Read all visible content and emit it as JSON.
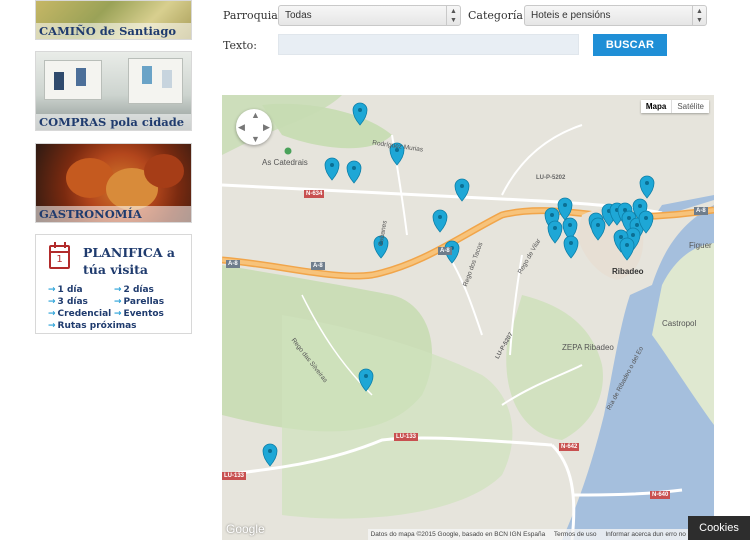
{
  "sidebar": {
    "promos": [
      {
        "label": "CAMIÑO de Santiago"
      },
      {
        "label": "COMPRAS pola cidade"
      },
      {
        "label": "GASTRONOMÍA"
      }
    ],
    "planifica": {
      "title": "PLANIFICA a túa visita",
      "calendar_number": "1",
      "links": [
        "1 día",
        "2 días",
        "3 días",
        "Parellas",
        "Credencial",
        "Eventos",
        "Rutas próximas"
      ]
    }
  },
  "filters": {
    "parroquia_label": "Parroquia:",
    "parroquia_value": "Todas",
    "categoria_label": "Categoría:",
    "categoria_value": "Hoteis e pensións",
    "texto_label": "Texto:",
    "texto_value": "",
    "search_button": "BUSCAR"
  },
  "map": {
    "type_controls": {
      "map": "Mapa",
      "satellite": "Satélite"
    },
    "place_labels": {
      "catedrais": "As Catedrais",
      "ribadeo": "Ribadeo",
      "castropol": "Castropol",
      "figueres": "Figuer",
      "zepa": "ZEPA Ribadeo"
    },
    "street_labels": [
      "Rodríguez Murias",
      "Rego dos Tacos",
      "Rego de Vilar",
      "Cabanes",
      "Rego das Silveiras",
      "Ría de Ribadeo o del Eo"
    ],
    "road_labels": [
      "N-634",
      "A-8",
      "A-8",
      "A-8",
      "LU-P-5202",
      "LU-P-5207",
      "LU-133",
      "N-642",
      "N-640",
      "LU-133",
      "A-8"
    ],
    "attribution": [
      "Datos do mapa ©2015 Google, basado en BCN IGN España",
      "Termos de uso",
      "Informar acerca dun erro no mapa"
    ],
    "google_logo": "Google",
    "marker_color": "#1ea7d6"
  },
  "cookies_button": "Cookies"
}
